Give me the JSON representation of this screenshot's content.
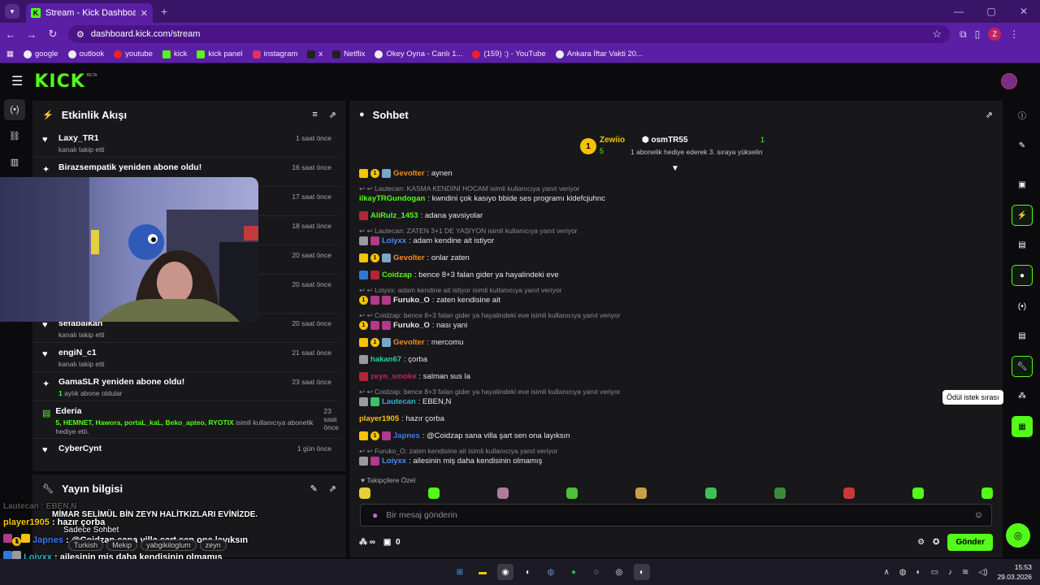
{
  "browser": {
    "tab_title": "Stream - Kick Dashboard",
    "url": "dashboard.kick.com/stream",
    "profile_letter": "Z",
    "bookmarks": [
      "google",
      "outlook",
      "youtube",
      "kick",
      "kick panel",
      "instagram",
      "x",
      "Netflix",
      "Okey Oyna - Canlı 1...",
      "(159) :) - YouTube",
      "Ankara İftar Vakti 20..."
    ]
  },
  "kick": {
    "logo": "KICK",
    "logo_beta": "BETA"
  },
  "activity": {
    "title": "Etkinlik Akışı",
    "rows": [
      {
        "name": "Laxy_TR1",
        "sub": "kanalı takip etti",
        "time": "1 saat önce",
        "icon": "heart-icon"
      },
      {
        "name": "Birazsempatik yeniden abone oldu!",
        "sub": "",
        "time": "16 saat önce",
        "icon": "sparkle-icon"
      },
      {
        "name": "",
        "sub": "",
        "time": "17 saat önce",
        "icon": "heart-icon"
      },
      {
        "name": "",
        "sub": "",
        "time": "18 saat önce",
        "icon": "heart-icon"
      },
      {
        "name": "",
        "sub": "",
        "time": "20 saat önce",
        "icon": "heart-icon"
      },
      {
        "name": "",
        "sub": "",
        "time": "20 saat önce",
        "icon": "heart-icon"
      },
      {
        "name": "sefabalkan",
        "sub": "kanalı takip etti",
        "time": "20 saat önce",
        "icon": "heart-icon"
      },
      {
        "name": "engiN_c1",
        "sub": "kanalı takip etti",
        "time": "21 saat önce",
        "icon": "heart-icon"
      },
      {
        "name": "GamaSLR yeniden abone oldu!",
        "sub_count": "1",
        "sub": "aylık abone oldular",
        "time": "23 saat önce",
        "icon": "sparkle-icon"
      },
      {
        "name": "Ederia",
        "sub_names": "5, HEMNET, Hawora, portaL_kaL, Beko_apteo, RYOTIX",
        "sub": "isimli kullanıcıya abonelik hediye etti.",
        "time": "23 saat önce",
        "icon": "gift-icon"
      },
      {
        "name": "CyberCynt",
        "sub": "",
        "time": "1 gün önce",
        "icon": "heart-icon"
      }
    ]
  },
  "stream_info": {
    "title": "Yayın bilgisi",
    "stream_title": "MİMAR SELİMÜL BİN ZEYN HALİTKIZLARI EVİNİZDE.",
    "chat_mode": "Sadece Sohbet",
    "tags": [
      "Turkish",
      "Mekip",
      "yabgikiloglum",
      "zeyn"
    ]
  },
  "overlay": {
    "faded": "Lautecan : EBEN,N",
    "lines": [
      {
        "user": "player1905",
        "text": " : hazır çorba"
      },
      {
        "user": "Japnes",
        "text": " : @Coidzap sana villa şart sen ona layıksın"
      },
      {
        "user": "Loiyxx",
        "text": " : ailesinin miş daha kendisinin olmamış"
      }
    ]
  },
  "chat": {
    "title": "Sohbet",
    "pinned": {
      "rank": "1",
      "user1": "Zewiio",
      "count1": "5",
      "user2": "osmTR55",
      "count2": "1",
      "desc": "1 abonelik hediye ederek 3. sıraya yükselin"
    },
    "messages": [
      {
        "type": "msg",
        "badges": [
          "gold",
          "coin",
          "sub"
        ],
        "user": "Gevolter",
        "color": "#f08a24",
        "text": ": aynen"
      },
      {
        "type": "reply",
        "text": "Lautecan: KASMA KENDİNİ HOCAM isimli kullanıcıya yanıt veriyor"
      },
      {
        "type": "msg",
        "badges": [],
        "user": "ilkayTRGundogan",
        "color": "#53fc18",
        "text": ": kwndini çok kasıyo bbide ses programı kldefcjuhnc"
      },
      {
        "type": "msg",
        "badges": [
          "red"
        ],
        "user": "AliRulz_1453",
        "color": "#53fc18",
        "text": ": adana yavsiyolar"
      },
      {
        "type": "reply",
        "text": "Lautecan: ZATEN 3+1 DE YAŞIYON isimli kullanıcıya yanıt veriyor"
      },
      {
        "type": "msg",
        "badges": [
          "cat",
          "mag"
        ],
        "user": "Loiyxx",
        "color": "#4b8cf5",
        "text": ": adam kendine ait istiyor"
      },
      {
        "type": "msg",
        "badges": [
          "gold",
          "coin",
          "sub"
        ],
        "user": "Gevolter",
        "color": "#f08a24",
        "text": ": onlar zaten"
      },
      {
        "type": "msg",
        "badges": [
          "blu",
          "red"
        ],
        "user": "Coidzap",
        "color": "#53fc18",
        "text": ": bence 8+3 falan gider ya hayalindeki eve"
      },
      {
        "type": "reply",
        "text": "Loiyxx: adam kendine ait istiyor isimli kullanıcıya yanıt veriyor"
      },
      {
        "type": "msg",
        "badges": [
          "coin",
          "mag",
          "mag"
        ],
        "user": "Furuko_O",
        "color": "#e8e8ea",
        "text": ": zaten kendisine ait"
      },
      {
        "type": "reply",
        "text": "Coidzap: bence 8+3 falan gider ya hayalindeki eve isimli kullanıcıya yanıt veriyor"
      },
      {
        "type": "msg",
        "badges": [
          "coin",
          "mag",
          "mag"
        ],
        "user": "Furuko_O",
        "color": "#e8e8ea",
        "text": ": nası yani"
      },
      {
        "type": "msg",
        "badges": [
          "gold",
          "coin",
          "sub"
        ],
        "user": "Gevolter",
        "color": "#f08a24",
        "text": ": mercomu"
      },
      {
        "type": "msg",
        "badges": [
          "cat"
        ],
        "user": "hakan67",
        "color": "#2bd0a6",
        "text": ": çorba"
      },
      {
        "type": "msg",
        "badges": [
          "red"
        ],
        "user": "zeyn_smoke",
        "color": "#c0245e",
        "text": ": salman sus la"
      },
      {
        "type": "reply",
        "text": "Coidzap: bence 8+3 falan gider ya hayalindeki eve isimli kullanıcıya yanıt veriyor"
      },
      {
        "type": "msg",
        "badges": [
          "cat",
          "grn"
        ],
        "user": "Lautecan",
        "color": "#2bb3c9",
        "text": ": EBEN,N"
      },
      {
        "type": "msg",
        "badges": [],
        "user": "player1905",
        "color": "#f5c400",
        "text": ": hazır çorba"
      },
      {
        "type": "msg",
        "badges": [
          "gold",
          "coin",
          "mag"
        ],
        "user": "Japnes",
        "color": "#3b7af0",
        "text": ": @Coidzap sana villa şart sen ona layıksın"
      },
      {
        "type": "reply",
        "text": "Furuko_O: zaten kendisine ait isimli kullanıcıya yanıt veriyor"
      },
      {
        "type": "msg",
        "badges": [
          "cat",
          "mag"
        ],
        "user": "Loiyxx",
        "color": "#4b8cf5",
        "text": ": ailesinin miş daha kendisinin olmamış"
      }
    ],
    "followers_label": "Takipçilere Özel",
    "input_placeholder": "Bir mesaj gönderin",
    "points": "∞",
    "gift_count": "0",
    "send_label": "Gönder"
  },
  "right_rail": {
    "tooltip": "Ödül istek sırası"
  },
  "taskbar": {
    "time": "15:53",
    "date": "29.03.2026"
  },
  "colors": {
    "accent": "#53fc18",
    "browser": "#5b1fa5",
    "panel": "#18181b"
  }
}
